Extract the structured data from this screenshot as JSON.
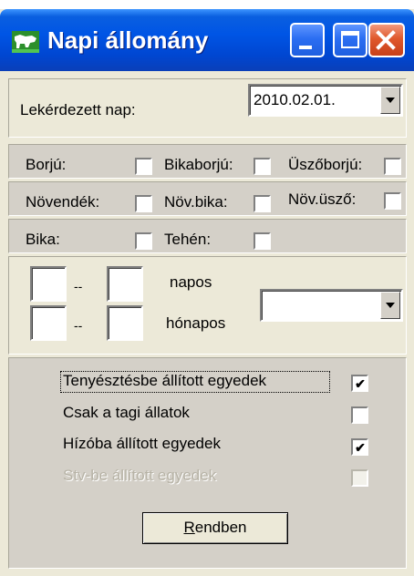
{
  "window": {
    "title": "Napi állomány",
    "title_color": "#0055e5",
    "buttons": [
      "minimize-icon",
      "maximize-icon",
      "close-icon"
    ]
  },
  "date_section": {
    "label": "Lekérdezett nap:",
    "date_value": "2010.02.01."
  },
  "checkbox_groups": {
    "borju": {
      "label": "Borjú:",
      "checked": false
    },
    "bikaborju": {
      "label": "Bikaborjú:",
      "checked": false
    },
    "uszoborju": {
      "label": "Üszőborjú:",
      "checked": false
    },
    "novendek": {
      "label": "Növendék:",
      "checked": false
    },
    "novbika": {
      "label": "Növ.bika:",
      "checked": false
    },
    "novuszo": {
      "label": "Növ.üsző:",
      "checked": false
    },
    "bika": {
      "label": "Bika:",
      "checked": false
    },
    "tehen": {
      "label": "Tehén:",
      "checked": false
    }
  },
  "age_range": {
    "dash": "--",
    "days_unit": "napos",
    "months_unit": "hónapos",
    "days_from": "",
    "days_to": "",
    "months_from": "",
    "months_to": "",
    "dropdown_value": ""
  },
  "options": [
    {
      "label": "Tenyésztésbe állított egyedek",
      "checked": true,
      "enabled": true
    },
    {
      "label": "Csak a tagi állatok",
      "checked": false,
      "enabled": true
    },
    {
      "label": "Hízóba állított egyedek",
      "checked": true,
      "enabled": true
    },
    {
      "label": "Stv-be állított egyedek",
      "checked": false,
      "enabled": false
    }
  ],
  "ok_button": {
    "mnemonic": "R",
    "rest": "endben"
  },
  "check_mark": "✔"
}
